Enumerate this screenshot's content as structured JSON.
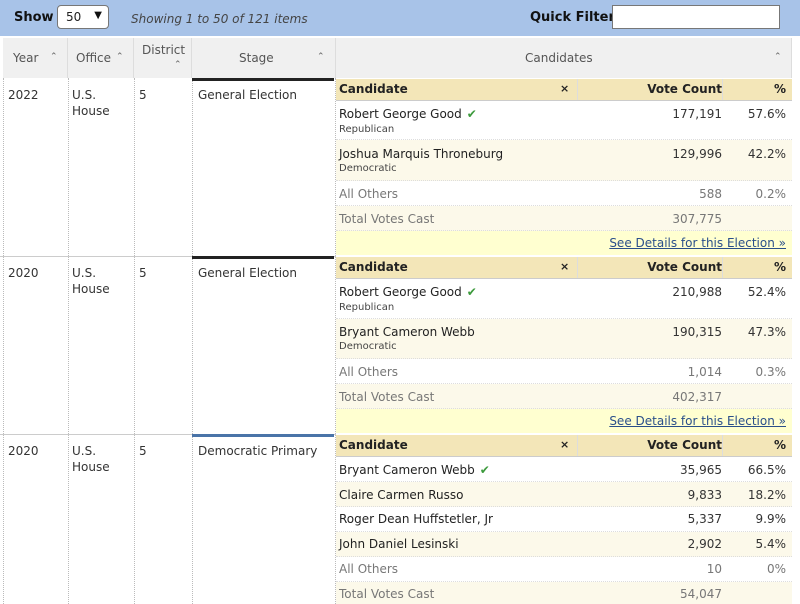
{
  "toolbar": {
    "show_label": "Show",
    "page_size": "50",
    "showing_text": "Showing 1 to 50 of 121 items",
    "quick_filter_label": "Quick Filter:",
    "quick_filter_value": ""
  },
  "columns": {
    "year": "Year",
    "office": "Office",
    "district": "District",
    "stage": "Stage",
    "candidates": "Candidates"
  },
  "sub_headers": {
    "candidate": "Candidate",
    "close": "×",
    "vote_count": "Vote Count",
    "pct": "%"
  },
  "rows": [
    {
      "year": "2022",
      "office_line1": "U.S.",
      "office_line2": "House",
      "district": "5",
      "stage": "General Election",
      "candidates": [
        {
          "name": "Robert George Good",
          "party": "Republican",
          "votes": "177,191",
          "pct": "57.6%"
        },
        {
          "name": "Joshua Marquis Throneburg",
          "party": "Democratic",
          "votes": "129,996",
          "pct": "42.2%"
        }
      ],
      "others": {
        "label": "All Others",
        "votes": "588",
        "pct": "0.2%"
      },
      "total": {
        "label": "Total Votes Cast",
        "votes": "307,775"
      },
      "details": "See Details for this Election »"
    },
    {
      "year": "2020",
      "office_line1": "U.S.",
      "office_line2": "House",
      "district": "5",
      "stage": "General Election",
      "candidates": [
        {
          "name": "Robert George Good",
          "party": "Republican",
          "votes": "210,988",
          "pct": "52.4%"
        },
        {
          "name": "Bryant Cameron Webb",
          "party": "Democratic",
          "votes": "190,315",
          "pct": "47.3%"
        }
      ],
      "others": {
        "label": "All Others",
        "votes": "1,014",
        "pct": "0.3%"
      },
      "total": {
        "label": "Total Votes Cast",
        "votes": "402,317"
      },
      "details": "See Details for this Election »"
    },
    {
      "year": "2020",
      "office_line1": "U.S.",
      "office_line2": "House",
      "district": "5",
      "stage": "Democratic Primary",
      "candidates": [
        {
          "name": "Bryant Cameron Webb",
          "votes": "35,965",
          "pct": "66.5%"
        },
        {
          "name": "Claire Carmen Russo",
          "votes": "9,833",
          "pct": "18.2%"
        },
        {
          "name": "Roger Dean Huffstetler, Jr",
          "votes": "5,337",
          "pct": "9.9%"
        },
        {
          "name": "John Daniel Lesinski",
          "votes": "2,902",
          "pct": "5.4%"
        }
      ],
      "others": {
        "label": "All Others",
        "votes": "10",
        "pct": "0%"
      },
      "total": {
        "label": "Total Votes Cast",
        "votes": "54,047"
      }
    }
  ],
  "colors": {
    "topbar": "#a8c3e8",
    "header_gold": "#f3e6b8",
    "winner_check": "#3c9a3c",
    "details_bg": "#ffffd0"
  }
}
